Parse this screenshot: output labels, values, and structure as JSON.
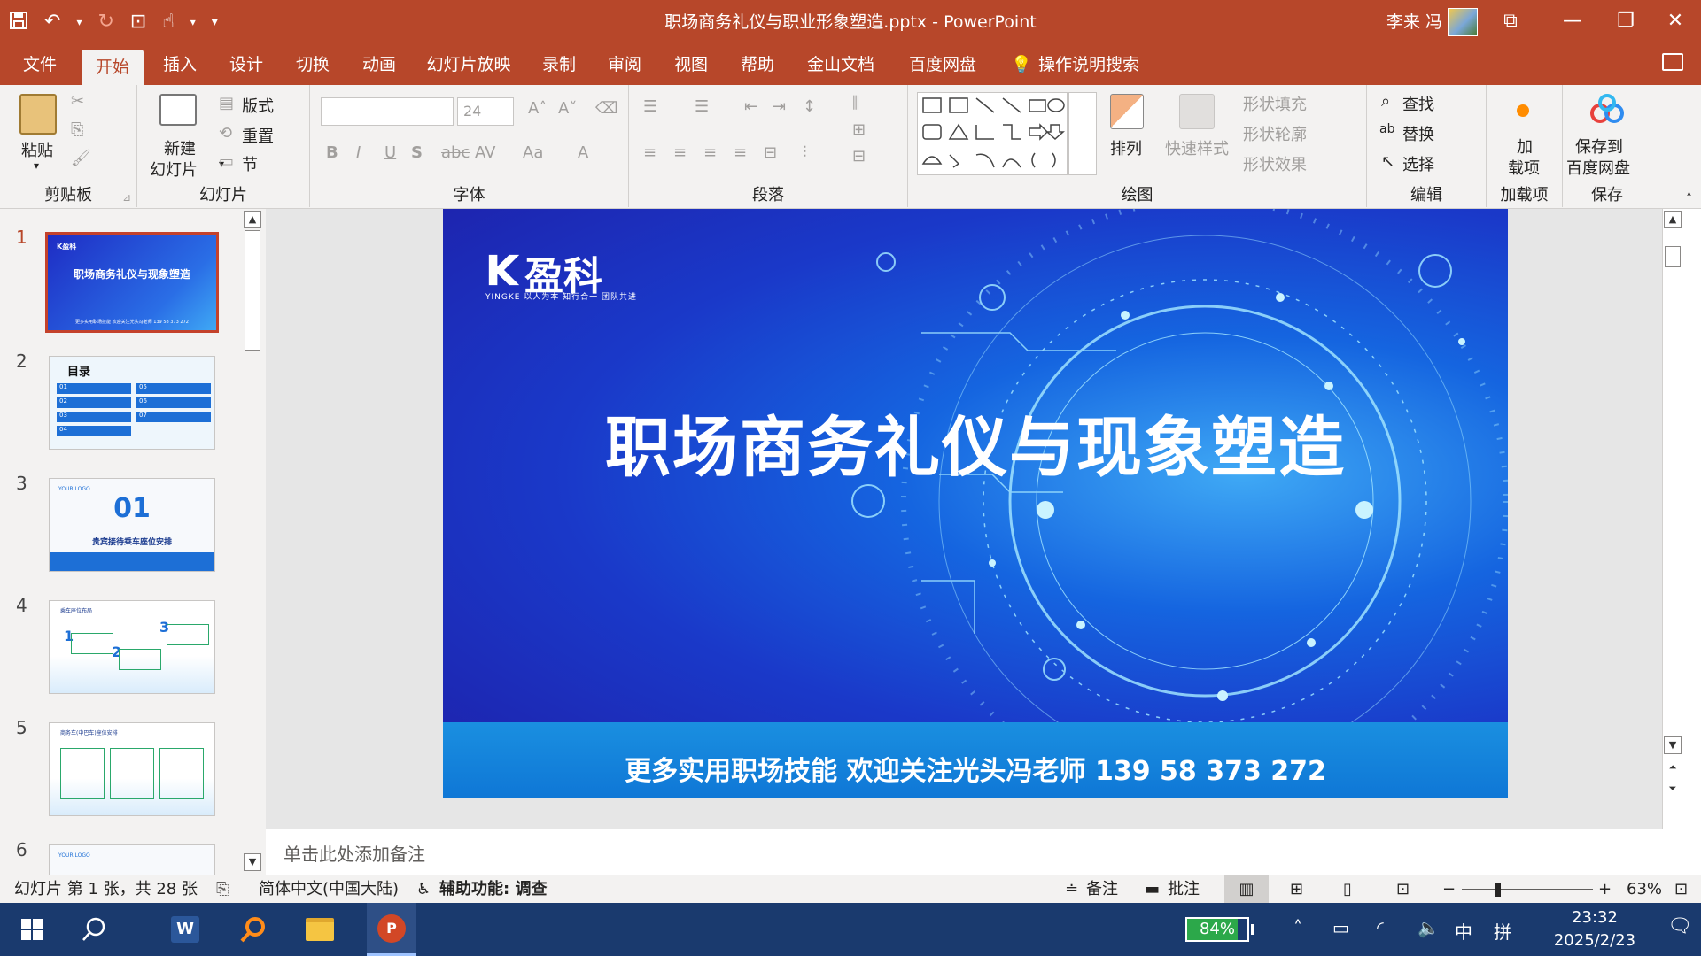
{
  "window": {
    "title": "职场商务礼仪与职业形象塑造.pptx  -  PowerPoint",
    "user": "李来 冯"
  },
  "tabs": [
    "文件",
    "开始",
    "插入",
    "设计",
    "切换",
    "动画",
    "幻灯片放映",
    "录制",
    "审阅",
    "视图",
    "帮助",
    "金山文档",
    "百度网盘",
    "操作说明搜索"
  ],
  "ribbon": {
    "clipboard": {
      "paste": "粘贴",
      "label": "剪贴板"
    },
    "slides": {
      "new_slide_1": "新建",
      "new_slide_2": "幻灯片",
      "layout": "版式",
      "reset": "重置",
      "section": "节",
      "label": "幻灯片"
    },
    "font": {
      "size": "24",
      "bold": "B",
      "italic": "I",
      "underline": "U",
      "shadow": "S",
      "strike": "abc",
      "spacing": "AV",
      "case": "Aa",
      "color": "A",
      "label": "字体"
    },
    "paragraph": {
      "label": "段落"
    },
    "drawing": {
      "arrange": "排列",
      "quick_styles": "快速样式",
      "shape_fill": "形状填充",
      "shape_outline": "形状轮廓",
      "shape_effects": "形状效果",
      "label": "绘图"
    },
    "editing": {
      "find": "查找",
      "replace": "替换",
      "select": "选择",
      "label": "编辑"
    },
    "addins": {
      "btn_1": "加",
      "btn_2": "载项",
      "label": "加载项"
    },
    "save": {
      "btn_1": "保存到",
      "btn_2": "百度网盘",
      "label": "保存"
    }
  },
  "thumbnails": [
    {
      "num": "1",
      "title": "职场商务礼仪与现象塑造",
      "logo": "K盈科",
      "footer": "更多实用职场技能 欢迎关注光头冯老师 139 58 373 272"
    },
    {
      "num": "2",
      "title": "目录",
      "items": [
        "01",
        "02",
        "03",
        "04",
        "05",
        "06",
        "07"
      ]
    },
    {
      "num": "3",
      "logo": "YOUR LOGO",
      "big": "01",
      "caption": "贵宾接待乘车座位安排"
    },
    {
      "num": "4",
      "header": "乘车座位布局",
      "steps": [
        "1",
        "2",
        "3"
      ]
    },
    {
      "num": "5",
      "header": "商务车(中巴车)座位安排"
    },
    {
      "num": "6",
      "logo": "YOUR LOGO"
    }
  ],
  "slide": {
    "logo_name": "盈科",
    "logo_sub": "YINGKE 以人为本 知行合一 团队共进",
    "title": "职场商务礼仪与现象塑造",
    "footer": "更多实用职场技能 欢迎关注光头冯老师 139 58 373 272"
  },
  "notes": {
    "placeholder": "单击此处添加备注"
  },
  "status": {
    "slide_info": "幻灯片 第 1 张，共 28 张",
    "language": "简体中文(中国大陆)",
    "accessibility": "辅助功能: 调查",
    "notes_btn": "备注",
    "comments_btn": "批注",
    "zoom": "63%"
  },
  "taskbar": {
    "battery": "84%",
    "ime_lang": "中",
    "ime_mode": "拼",
    "time": "23:32",
    "date": "2025/2/23"
  },
  "colors": {
    "accent": "#b7472a",
    "slide_blue": "#1a39c9",
    "taskbar": "#1a3a6e"
  }
}
